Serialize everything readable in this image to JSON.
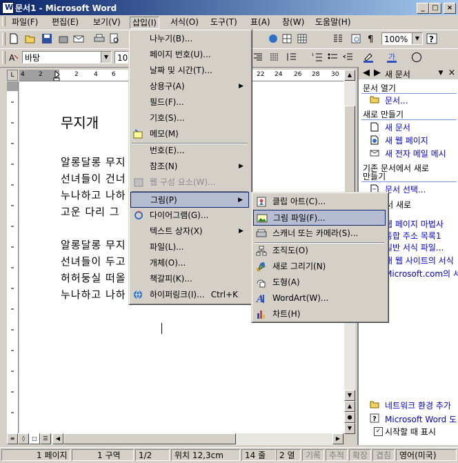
{
  "window": {
    "title": "문서1 - Microsoft Word"
  },
  "menubar": [
    "파일(F)",
    "편집(E)",
    "보기(V)",
    "삽입(I)",
    "서식(O)",
    "도구(T)",
    "표(A)",
    "창(W)",
    "도움말(H)"
  ],
  "toolbar": {
    "zoom": "100%",
    "style": "바탕",
    "font_size": "10"
  },
  "ruler": {
    "numbers": [
      "4",
      "2",
      "2",
      "4",
      "6",
      "22",
      "24",
      "26",
      "28",
      "30"
    ]
  },
  "document": {
    "title": "무지개",
    "lines": [
      "알롱달롱 무지",
      "선녀들이 건너",
      "누나하고 나하",
      "고운 다리 그",
      "알롱달롱 무지",
      "선녀들이 두고",
      "허허둥실 떠올",
      "누나하고 나하"
    ]
  },
  "insert_menu": {
    "items": [
      {
        "label": "나누기(B)...",
        "shortcut": "",
        "submenu": false,
        "disabled": false,
        "highlighted": false
      },
      {
        "label": "페이지 번호(U)...",
        "shortcut": "",
        "submenu": false,
        "disabled": false,
        "highlighted": false
      },
      {
        "label": "날짜 및 시간(T)...",
        "shortcut": "",
        "submenu": false,
        "disabled": false,
        "highlighted": false
      },
      {
        "label": "상용구(A)",
        "shortcut": "",
        "submenu": true,
        "disabled": false,
        "highlighted": false
      },
      {
        "label": "필드(F)...",
        "shortcut": "",
        "submenu": false,
        "disabled": false,
        "highlighted": false
      },
      {
        "label": "기호(S)...",
        "shortcut": "",
        "submenu": false,
        "disabled": false,
        "highlighted": false
      },
      {
        "label": "메모(M)",
        "shortcut": "",
        "submenu": false,
        "disabled": false,
        "highlighted": false
      },
      {
        "label": "번호(E)...",
        "shortcut": "",
        "submenu": false,
        "disabled": false,
        "highlighted": false
      },
      {
        "label": "참조(N)",
        "shortcut": "",
        "submenu": true,
        "disabled": false,
        "highlighted": false
      },
      {
        "label": "웹 구성 요소(W)...",
        "shortcut": "",
        "submenu": false,
        "disabled": true,
        "highlighted": false
      },
      {
        "label": "그림(P)",
        "shortcut": "",
        "submenu": true,
        "disabled": false,
        "highlighted": true
      },
      {
        "label": "다이어그램(G)...",
        "shortcut": "",
        "submenu": false,
        "disabled": false,
        "highlighted": false
      },
      {
        "label": "텍스트 상자(X)",
        "shortcut": "",
        "submenu": true,
        "disabled": false,
        "highlighted": false
      },
      {
        "label": "파일(L)...",
        "shortcut": "",
        "submenu": false,
        "disabled": false,
        "highlighted": false
      },
      {
        "label": "개체(O)...",
        "shortcut": "",
        "submenu": false,
        "disabled": false,
        "highlighted": false
      },
      {
        "label": "책갈피(K)...",
        "shortcut": "",
        "submenu": false,
        "disabled": false,
        "highlighted": false
      },
      {
        "label": "하이퍼링크(I)...",
        "shortcut": "Ctrl+K",
        "submenu": false,
        "disabled": false,
        "highlighted": false
      }
    ]
  },
  "picture_submenu": {
    "items": [
      {
        "label": "클립 아트(C)...",
        "highlighted": false
      },
      {
        "label": "그림 파일(F)...",
        "highlighted": true
      },
      {
        "label": "스캐너 또는 카메라(S)...",
        "highlighted": false
      },
      {
        "label": "조직도(O)",
        "highlighted": false
      },
      {
        "label": "새로 그리기(N)",
        "highlighted": false
      },
      {
        "label": "도형(A)",
        "highlighted": false
      },
      {
        "label": "WordArt(W)...",
        "highlighted": false
      },
      {
        "label": "차트(H)",
        "highlighted": false
      }
    ]
  },
  "task_pane": {
    "title": "새 문서",
    "open_header": "문서 열기",
    "open_link": "문서...",
    "new_header": "새로 만들기",
    "new_links": [
      "새 문서",
      "새 웹 페이지",
      "새 전자 메일 메시"
    ],
    "existing_header_1": "기존 문서에서 새로",
    "existing_header_2": "만들기",
    "existing_link": "문서 선택...",
    "template_header": "파일에서 새로",
    "template_links": [
      "웹 페이지 마법사",
      "통합 주소 목록1",
      "일반 서식 파일...",
      "내 웹 사이트의 서식",
      "Microsoft.com의 서"
    ],
    "bottom_links": [
      "네트워크 환경 추가",
      "Microsoft Word 도"
    ],
    "startup_checkbox": "시작할 때 표시",
    "startup_checked": true
  },
  "status_bar": {
    "page": "1 페이지",
    "section": "1 구역",
    "pages": "1/2",
    "position": "위치 12,3cm",
    "line": "14 줄",
    "col": "2 열",
    "rec": "기록",
    "trk": "추적",
    "ext": "확장",
    "ovr": "겹침",
    "lang": "영어(미국)"
  }
}
